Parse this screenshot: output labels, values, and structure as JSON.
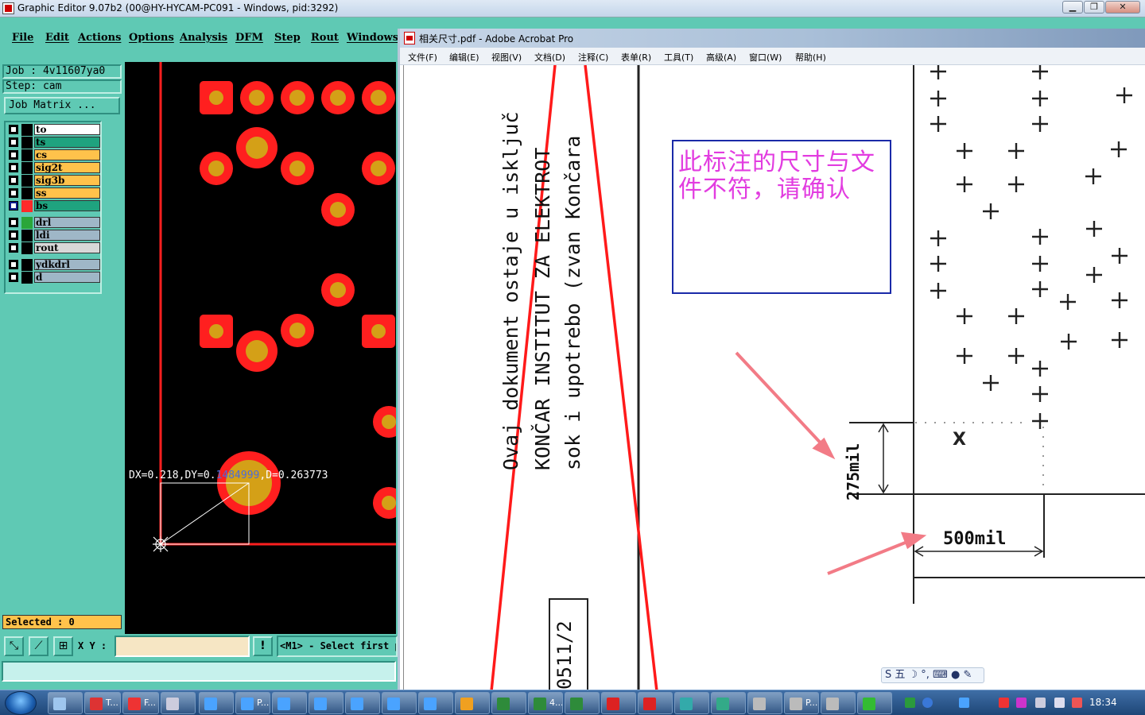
{
  "ge": {
    "title": "Graphic Editor 9.07b2 (00@HY-HYCAM-PC091 - Windows, pid:3292)",
    "menu": [
      "File",
      "Edit",
      "Actions",
      "Options",
      "Analysis",
      "DFM",
      "Step",
      "Rout",
      "Windows"
    ],
    "job_line": "Job  : 4v11607ya0",
    "step_line": "Step: cam",
    "job_matrix_label": "Job Matrix ...",
    "layers": [
      {
        "name": "to",
        "color": "#ffffff",
        "swatch": "#000000"
      },
      {
        "name": "ts",
        "color": "#1fa37f",
        "swatch": "#000000"
      },
      {
        "name": "cs",
        "color": "#ffc24b",
        "swatch": "#000000"
      },
      {
        "name": "sig2t",
        "color": "#ffc24b",
        "swatch": "#000000"
      },
      {
        "name": "sig3b",
        "color": "#ffc24b",
        "swatch": "#000000"
      },
      {
        "name": "ss",
        "color": "#ffc24b",
        "swatch": "#000000"
      },
      {
        "name": "bs",
        "color": "#1fa37f",
        "swatch": "#ff2a2a",
        "active": true
      },
      {
        "name": "drl",
        "color": "#9fb7c7",
        "swatch": "#2aa63a"
      },
      {
        "name": "ldi",
        "color": "#9fb7c7",
        "swatch": "#000000"
      },
      {
        "name": "rout",
        "color": "#d8d8d8",
        "swatch": "#000000"
      },
      {
        "name": "ydkdrl",
        "color": "#9fb7c7",
        "swatch": "#000000"
      },
      {
        "name": "d",
        "color": "#9fb7c7",
        "swatch": "#000000"
      }
    ],
    "selected_label": "Selected : 0",
    "measure": {
      "prefix": "DX=0.218,DY=0.",
      "highlight": "1484999",
      "suffix": ",D=0.263773"
    },
    "xy_label": "X Y :",
    "xy_value": "",
    "prompt": "<M1> - Select first p",
    "colors": {
      "panel": "#5fc9b4",
      "pad_outer": "#ff1f1f",
      "pad_inner": "#d4a017",
      "outline": "#ff1f1f"
    }
  },
  "acrobat": {
    "title": "相关尺寸.pdf - Adobe Acrobat Pro",
    "menu": [
      "文件(F)",
      "编辑(E)",
      "视图(V)",
      "文档(D)",
      "注释(C)",
      "表单(R)",
      "工具(T)",
      "高级(A)",
      "窗口(W)",
      "帮助(H)"
    ],
    "doc_lines": [
      "Ovaj dokument ostaje u isključ",
      "KONČAR INSTITUT ZA ELEKTROT",
      "sok i upotrebo (zvan Končara"
    ],
    "doc_number": "0511/2",
    "comment": "此标注的尺寸与文件不符，请确认",
    "dim_width": "500mil",
    "dim_height": "275mil"
  },
  "taskbar": {
    "clock": "18:34",
    "buttons": [
      {
        "label": "",
        "icon": "grid-icon",
        "color": "#9ec6ee"
      },
      {
        "label": "T...",
        "icon": "disk-icon",
        "color": "#d33"
      },
      {
        "label": "F...",
        "icon": "ge-icon",
        "color": "#e33"
      },
      {
        "label": "",
        "icon": "calc-icon",
        "color": "#ccd"
      },
      {
        "label": "",
        "icon": "frontline-icon",
        "color": "#4aa3ff"
      },
      {
        "label": "P...",
        "icon": "frontline-icon",
        "color": "#4aa3ff"
      },
      {
        "label": "",
        "icon": "frontline-icon",
        "color": "#4aa3ff"
      },
      {
        "label": "",
        "icon": "frontline-icon",
        "color": "#4aa3ff"
      },
      {
        "label": "",
        "icon": "frontline-icon",
        "color": "#4aa3ff"
      },
      {
        "label": "",
        "icon": "frontline-icon",
        "color": "#4aa3ff"
      },
      {
        "label": "",
        "icon": "frontline-icon",
        "color": "#4aa3ff"
      },
      {
        "label": "",
        "icon": "star-icon",
        "color": "#f0a020"
      },
      {
        "label": "",
        "icon": "excel-icon",
        "color": "#2e8b3a"
      },
      {
        "label": "4...",
        "icon": "excel-icon",
        "color": "#2e8b3a"
      },
      {
        "label": "",
        "icon": "excel-icon",
        "color": "#2e8b3a"
      },
      {
        "label": "",
        "icon": "pdf-icon",
        "color": "#d22"
      },
      {
        "label": "",
        "icon": "pdf-icon",
        "color": "#d22"
      },
      {
        "label": "",
        "icon": "eye-icon",
        "color": "#3aa"
      },
      {
        "label": "",
        "icon": "globe-icon",
        "color": "#3a8"
      },
      {
        "label": "",
        "icon": "x-window-icon",
        "color": "#bbb"
      },
      {
        "label": "P...",
        "icon": "x-window-icon",
        "color": "#bbb"
      },
      {
        "label": "",
        "icon": "x-window-icon",
        "color": "#bbb"
      },
      {
        "label": "",
        "icon": "p-icon",
        "color": "#3b3"
      }
    ]
  }
}
